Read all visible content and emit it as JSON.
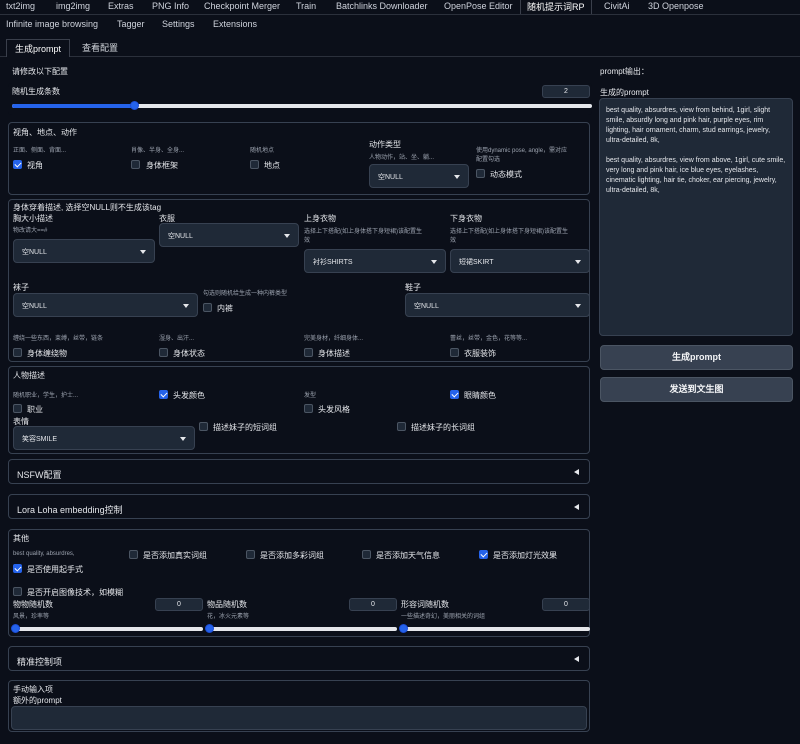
{
  "nav": {
    "row1": [
      "txt2img",
      "img2img",
      "Extras",
      "PNG Info",
      "Checkpoint Merger",
      "Train",
      "Batchlinks Downloader",
      "OpenPose Editor",
      "随机提示词RP",
      "CivitAi",
      "3D Openpose"
    ],
    "row2": [
      "Infinite image browsing",
      "Tagger",
      "Settings",
      "Extensions"
    ]
  },
  "subtabs": [
    "生成prompt",
    "查看配置"
  ],
  "left": {
    "header": "请修改以下配置",
    "random_count": {
      "label": "随机生成条数",
      "value": "2",
      "fraction": 0.21
    },
    "view": {
      "title": "视角、地点、动作",
      "col1_hint": "正面、侧面、背面...",
      "col1_label": "视角",
      "col2_hint": "肖像、半身、全身...",
      "col2_label": "身体框架",
      "col3_hint": "随机地点",
      "col3_label": "地点",
      "action_type_label": "动作类型",
      "action_type_hint": "人物动作，站、坐、躺...",
      "action_type_value": "空NULL",
      "dynamic_hint_1": "使用dynamic pose, angle，需对应",
      "dynamic_hint_2": "配置勾选",
      "dynamic_label": "动态模式"
    },
    "body": {
      "title": "身体穿着描述, 选择空NULL则不生成该tag",
      "chest_label": "胸大小描述",
      "chest_hint": "物改请大==#",
      "chest_value": "空NULL",
      "clothes_label": "衣服",
      "clothes_value": "空NULL",
      "upper_label": "上身衣物",
      "upper_hint_1": "选择上下搭配(如上身体搭下身短裙)该配置生",
      "upper_hint_2": "效",
      "upper_value": "衬衫SHIRTS",
      "lower_label": "下身衣物",
      "lower_hint_1": "选择上下搭配(如上身体搭下身短裙)该配置生",
      "lower_hint_2": "效",
      "lower_value": "短裙SKIRT",
      "socks_label": "袜子",
      "socks_value": "空NULL",
      "underwear_hint": "勾选则随机给生成一种内裤类型",
      "underwear_label": "内裤",
      "shoes_label": "鞋子",
      "shoes_value": "空NULL",
      "c1_hint": "缠绕一些东西，束缚，丝带，链条",
      "c1_label": "身体缠绕物",
      "c2_hint": "湿身、出汗...",
      "c2_label": "身体状态",
      "c3_hint": "完美身材，纤细身体...",
      "c3_label": "身体描述",
      "c4_hint": "蕾丝，丝带，金色，花等等...",
      "c4_label": "衣服装饰"
    },
    "person": {
      "title": "人物描述",
      "job_hint": "随机职业，学生，护士...",
      "job_label": "职业",
      "hair_color_label": "头发颜色",
      "hairstyle_hint": "发型",
      "hairstyle_label": "头发风格",
      "eye_color_label": "眼睛颜色",
      "expression_label": "表情",
      "expression_value": "笑容SMILE",
      "short_label": "描述妹子的短词组",
      "long_label": "描述妹子的长词组"
    },
    "nsfw_title": "NSFW配置",
    "lora_title": "Lora Loha embedding控制",
    "other": {
      "title": "其他",
      "quality_hint": "best quality, absurdres,",
      "real_label": "是否添加真实词组",
      "color_label": "是否添加多彩词组",
      "weather_label": "是否添加天气信息",
      "light_label": "是否添加灯光效果",
      "gesture_label": "是否使用起手式",
      "restore_label": "是否开启图像技术，如模糊",
      "obj_label": "物物随机数",
      "obj_hint": "风景，珍率等",
      "obj_value": "0",
      "item_label": "物品随机数",
      "item_hint": "花，冰火元素等",
      "item_value": "0",
      "adj_label": "形容词随机数",
      "adj_hint": "一些描述奇幻，美丽相关的词组",
      "adj_value": "0"
    },
    "precise_title": "精准控制项",
    "manual": {
      "title": "手动输入项",
      "extra_label": "额外的prompt"
    }
  },
  "right": {
    "title": "prompt输出：",
    "generated_label": "生成的prompt",
    "output_text_1": "best quality, absurdres, view from behind, 1girl, slight smile, absurdly long and pink hair, purple eyes, rim lighting, hair ornament, charm, stud earrings, jewelry, ultra-detailed, 8k,",
    "output_text_2": "best quality, absurdres, view from above, 1girl, cute smile, very long and pink hair, ice blue eyes, eyelashes, cinematic lighting, hair tie, choker, ear piercing, jewelry, ultra-detailed, 8k,",
    "gen_button": "生成prompt",
    "send_button": "发送到文生图"
  },
  "colors": {
    "bg": "#0b0f19",
    "accent": "#2563eb",
    "panel_border": "#374151"
  }
}
